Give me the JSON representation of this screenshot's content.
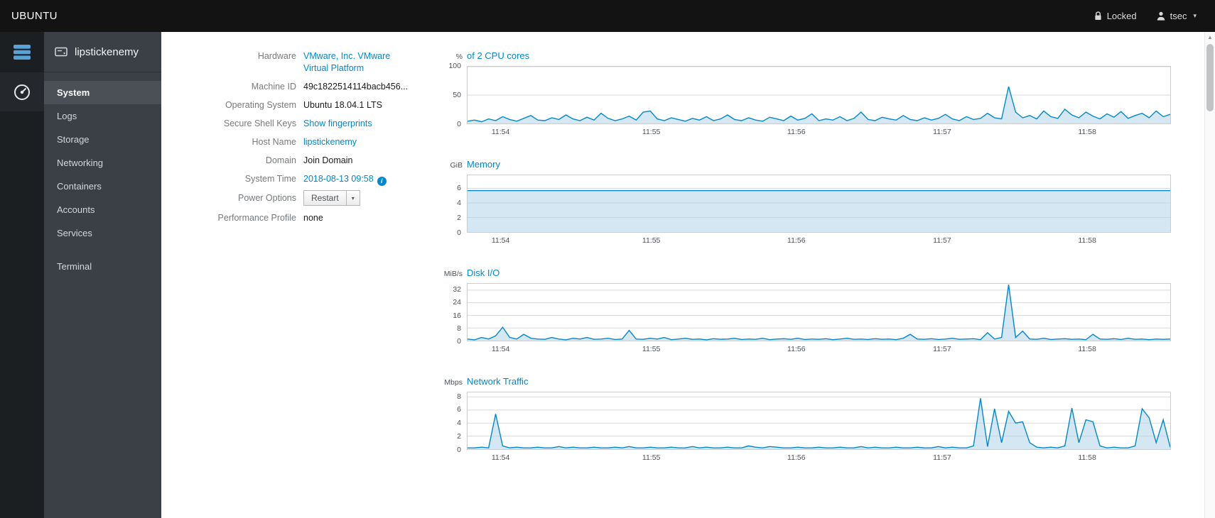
{
  "topbar": {
    "brand": "UBUNTU",
    "locked_label": "Locked",
    "user_label": "tsec"
  },
  "icons": {
    "chevron-down": "▾",
    "info": "i",
    "scroll-up-arrow": "▲"
  },
  "sidebar": {
    "host": "lipstickenemy",
    "items": [
      {
        "label": "System",
        "active": true,
        "separated": false
      },
      {
        "label": "Logs",
        "active": false,
        "separated": false
      },
      {
        "label": "Storage",
        "active": false,
        "separated": false
      },
      {
        "label": "Networking",
        "active": false,
        "separated": false
      },
      {
        "label": "Containers",
        "active": false,
        "separated": false
      },
      {
        "label": "Accounts",
        "active": false,
        "separated": false
      },
      {
        "label": "Services",
        "active": false,
        "separated": false
      },
      {
        "label": "Terminal",
        "active": false,
        "separated": true
      }
    ]
  },
  "system_info": {
    "fields": [
      {
        "label": "Hardware",
        "value": "VMware, Inc. VMware Virtual Platform",
        "style": "link"
      },
      {
        "label": "Machine ID",
        "value": "49c1822514114bacb456...",
        "style": "text"
      },
      {
        "label": "Operating System",
        "value": "Ubuntu 18.04.1 LTS",
        "style": "text"
      },
      {
        "label": "Secure Shell Keys",
        "value": "Show fingerprints",
        "style": "link"
      },
      {
        "label": "Host Name",
        "value": "lipstickenemy",
        "style": "link"
      },
      {
        "label": "Domain",
        "value": "Join Domain",
        "style": "action"
      },
      {
        "label": "System Time",
        "value": "2018-08-13 09:58",
        "style": "link-info"
      },
      {
        "label": "Power Options",
        "value": "Restart",
        "style": "split-button"
      },
      {
        "label": "Performance Profile",
        "value": "none",
        "style": "action"
      }
    ]
  },
  "colors": {
    "accent": "#0088ce",
    "chart_line": "#0088ce",
    "chart_fill": "#b3d3e8"
  },
  "chart_data": [
    {
      "type": "area",
      "unit": "%",
      "title": "of 2 CPU cores",
      "y_ticks": [
        0,
        50,
        100
      ],
      "ylim": [
        0,
        100
      ],
      "x_tick_labels": [
        "11:54",
        "11:55",
        "11:56",
        "11:57",
        "11:58"
      ],
      "x_tick_fractions": [
        0.048,
        0.262,
        0.468,
        0.675,
        0.881
      ],
      "values": [
        4,
        6,
        3,
        8,
        5,
        12,
        7,
        4,
        9,
        14,
        6,
        5,
        10,
        7,
        15,
        8,
        5,
        11,
        6,
        18,
        9,
        5,
        8,
        13,
        6,
        20,
        22,
        8,
        5,
        10,
        7,
        4,
        9,
        6,
        12,
        5,
        8,
        15,
        7,
        5,
        10,
        6,
        4,
        11,
        8,
        5,
        13,
        6,
        9,
        17,
        5,
        8,
        6,
        12,
        5,
        9,
        20,
        7,
        5,
        11,
        8,
        6,
        14,
        7,
        5,
        10,
        6,
        9,
        16,
        8,
        5,
        12,
        7,
        9,
        18,
        10,
        8,
        65,
        20,
        10,
        14,
        8,
        22,
        12,
        9,
        25,
        15,
        10,
        20,
        13,
        8,
        17,
        11,
        21,
        9,
        14,
        18,
        10,
        22,
        12,
        16
      ]
    },
    {
      "type": "area",
      "unit": "GiB",
      "title": "Memory",
      "y_ticks": [
        0,
        2,
        4,
        6
      ],
      "ylim": [
        0,
        7.8
      ],
      "x_tick_labels": [
        "11:54",
        "11:55",
        "11:56",
        "11:57",
        "11:58"
      ],
      "x_tick_fractions": [
        0.048,
        0.262,
        0.468,
        0.675,
        0.881
      ],
      "values": [
        5.7,
        5.7,
        5.7,
        5.7,
        5.7,
        5.7,
        5.7,
        5.7,
        5.7,
        5.7,
        5.7,
        5.7,
        5.7,
        5.7,
        5.7,
        5.7,
        5.7,
        5.7,
        5.7,
        5.7,
        5.7,
        5.7,
        5.7,
        5.7,
        5.7
      ]
    },
    {
      "type": "area",
      "unit": "MiB/s",
      "title": "Disk I/O",
      "y_ticks": [
        0,
        8,
        16,
        24,
        32
      ],
      "ylim": [
        0,
        36
      ],
      "x_tick_labels": [
        "11:54",
        "11:55",
        "11:56",
        "11:57",
        "11:58"
      ],
      "x_tick_fractions": [
        0.048,
        0.262,
        0.468,
        0.675,
        0.881
      ],
      "values": [
        1,
        0.5,
        2,
        1,
        3,
        8.5,
        2,
        1,
        4,
        1.5,
        1,
        0.8,
        2,
        1,
        0.5,
        1.5,
        1,
        2,
        0.8,
        1,
        1.5,
        0.7,
        1,
        6.5,
        1,
        0.8,
        1.5,
        1,
        2,
        0.6,
        1,
        1.5,
        0.8,
        1,
        0.5,
        1.2,
        0.8,
        1,
        1.5,
        0.7,
        1,
        0.8,
        1.5,
        0.6,
        1,
        1.2,
        0.8,
        1.5,
        0.7,
        1,
        0.8,
        1.2,
        0.6,
        1,
        1.5,
        0.8,
        1,
        0.7,
        1.2,
        0.8,
        1,
        0.6,
        1.5,
        4,
        1,
        0.8,
        1.2,
        0.7,
        1,
        1.5,
        0.8,
        1,
        1.2,
        0.6,
        5,
        1,
        2,
        35.5,
        2,
        6,
        1,
        0.8,
        1.5,
        0.7,
        1,
        1.2,
        0.8,
        1,
        0.6,
        4,
        1,
        0.8,
        1.2,
        0.7,
        1.5,
        0.8,
        1,
        0.6,
        1,
        0.8,
        1
      ]
    },
    {
      "type": "area",
      "unit": "Mbps",
      "title": "Network Traffic",
      "y_ticks": [
        0,
        2,
        4,
        6,
        8
      ],
      "ylim": [
        0,
        8.7
      ],
      "x_tick_labels": [
        "11:54",
        "11:55",
        "11:56",
        "11:57",
        "11:58"
      ],
      "x_tick_fractions": [
        0.048,
        0.262,
        0.468,
        0.675,
        0.881
      ],
      "values": [
        0.2,
        0.2,
        0.3,
        0.2,
        5.4,
        0.5,
        0.2,
        0.3,
        0.2,
        0.2,
        0.3,
        0.2,
        0.2,
        0.4,
        0.2,
        0.3,
        0.2,
        0.2,
        0.3,
        0.2,
        0.2,
        0.3,
        0.2,
        0.4,
        0.2,
        0.2,
        0.3,
        0.2,
        0.2,
        0.3,
        0.2,
        0.2,
        0.4,
        0.2,
        0.3,
        0.2,
        0.2,
        0.3,
        0.2,
        0.2,
        0.5,
        0.3,
        0.2,
        0.4,
        0.3,
        0.2,
        0.2,
        0.3,
        0.2,
        0.2,
        0.3,
        0.2,
        0.2,
        0.3,
        0.2,
        0.2,
        0.4,
        0.2,
        0.3,
        0.2,
        0.2,
        0.3,
        0.2,
        0.2,
        0.3,
        0.2,
        0.2,
        0.4,
        0.2,
        0.3,
        0.2,
        0.2,
        0.5,
        7.8,
        0.4,
        6.2,
        1,
        5.8,
        4,
        4.2,
        1,
        0.3,
        0.2,
        0.3,
        0.2,
        0.5,
        6.3,
        1,
        4.5,
        4.2,
        0.5,
        0.2,
        0.3,
        0.2,
        0.2,
        0.5,
        6.2,
        4.8,
        1,
        4.5,
        0.3
      ]
    }
  ]
}
